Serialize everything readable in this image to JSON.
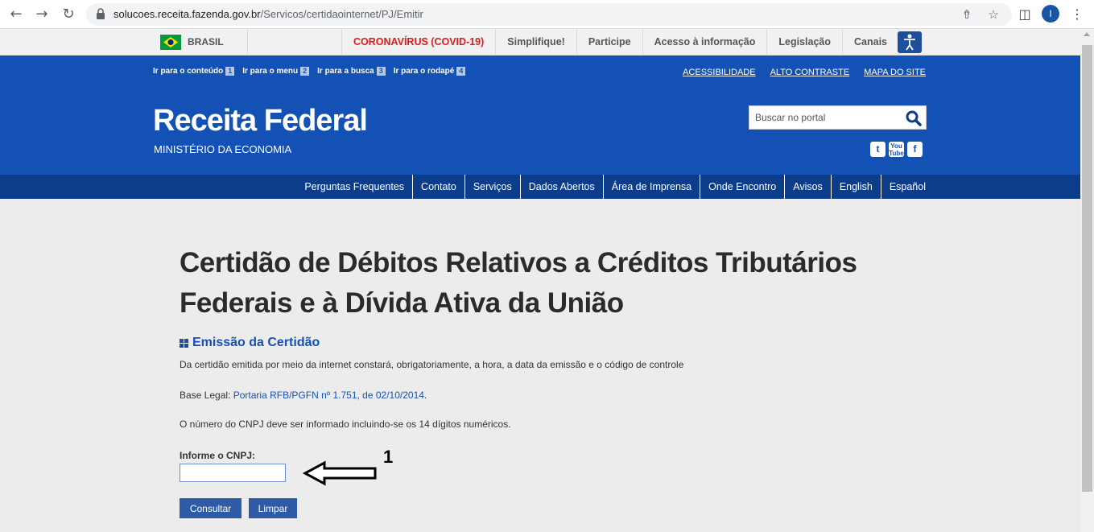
{
  "browser": {
    "url_host": "solucoes.receita.fazenda.gov.br",
    "url_path": "/Servicos/certidaointernet/PJ/Emitir",
    "avatar_letter": "I"
  },
  "gov_bar": {
    "country": "BRASIL",
    "links": [
      "CORONAVÍRUS (COVID-19)",
      "Simplifique!",
      "Participe",
      "Acesso à informação",
      "Legislação",
      "Canais"
    ]
  },
  "header": {
    "skip_links": [
      {
        "label": "Ir para o conteúdo",
        "num": "1"
      },
      {
        "label": "Ir para o menu",
        "num": "2"
      },
      {
        "label": "Ir para a busca",
        "num": "3"
      },
      {
        "label": "Ir para o rodapé",
        "num": "4"
      }
    ],
    "top_links": [
      "ACESSIBILIDADE",
      "ALTO CONTRASTE",
      "MAPA DO SITE"
    ],
    "title": "Receita Federal",
    "subtitle": "MINISTÉRIO DA ECONOMIA",
    "search_placeholder": "Buscar no portal",
    "social": [
      "twitter-icon",
      "youtube-icon",
      "facebook-icon"
    ]
  },
  "nav": {
    "items": [
      "Perguntas Frequentes",
      "Contato",
      "Serviços",
      "Dados Abertos",
      "Área de Imprensa",
      "Onde Encontro",
      "Avisos",
      "English",
      "Español"
    ]
  },
  "content": {
    "title_line1": "Certidão de Débitos Relativos a Créditos Tributários",
    "title_line2": "Federais e à Dívida Ativa da União",
    "section_title": "Emissão da Certidão",
    "info": "Da certidão emitida por meio da internet constará, obrigatoriamente, a hora, a data da emissão e o código de controle",
    "base_legal_label": "Base Legal:",
    "base_legal_link": "Portaria RFB/PGFN nº 1.751, de 02/10/2014",
    "base_legal_end": ".",
    "cnpj_note": "O número do CNPJ deve ser informado incluindo-se os 14 dígitos numéricos.",
    "cnpj_label": "Informe o CNPJ:",
    "cnpj_value": "",
    "btn_consultar": "Consultar",
    "btn_limpar": "Limpar",
    "annotation_number": "1"
  },
  "colors": {
    "header_blue": "#1351b4",
    "nav_blue": "#0c3d8a",
    "button_blue": "#2f5ba6",
    "covid_red": "#e01b1b"
  }
}
